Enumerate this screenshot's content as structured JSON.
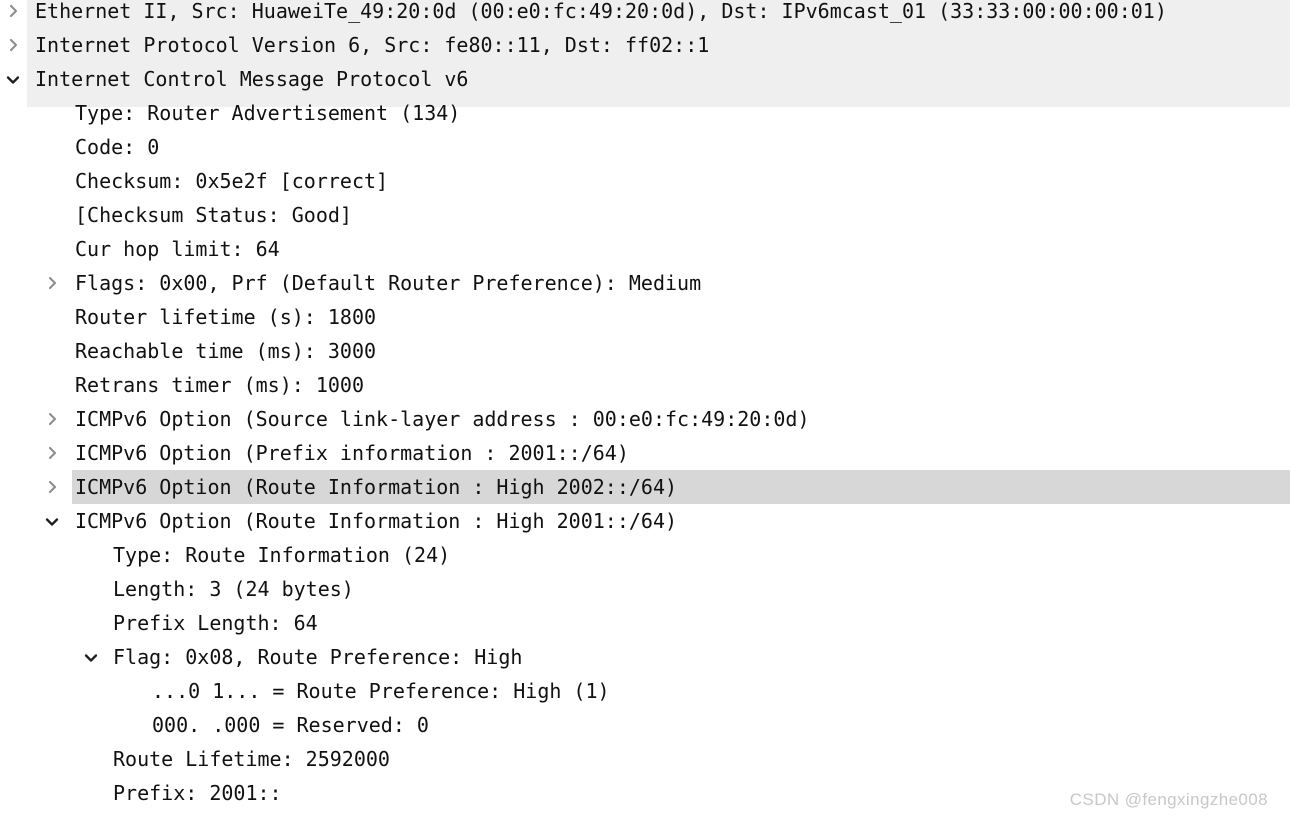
{
  "watermark": "CSDN @fengxingzhe008",
  "colors": {
    "band_background": "#efeff0",
    "selection_background": "#d7d7d7",
    "text": "#111111",
    "collapsed_arrow": "#8d8d8d",
    "expanded_arrow": "#1d1d1d",
    "watermark": "#c8c8c8"
  },
  "packet_detail": {
    "rows": [
      {
        "text": "Ethernet II, Src: HuaweiTe_49:20:0d (00:e0:fc:49:20:0d), Dst: IPv6mcast_01 (33:33:00:00:00:01)",
        "indent": 0,
        "twisty": "collapsed",
        "banded": true,
        "selected": false
      },
      {
        "text": "Internet Protocol Version 6, Src: fe80::11, Dst: ff02::1",
        "indent": 0,
        "twisty": "collapsed",
        "banded": true,
        "selected": false
      },
      {
        "text": "Internet Control Message Protocol v6",
        "indent": 0,
        "twisty": "expanded",
        "banded": true,
        "selected": false
      },
      {
        "text": "Type: Router Advertisement (134)",
        "indent": 1,
        "twisty": "none",
        "banded": false,
        "selected": false
      },
      {
        "text": "Code: 0",
        "indent": 1,
        "twisty": "none",
        "banded": false,
        "selected": false
      },
      {
        "text": "Checksum: 0x5e2f [correct]",
        "indent": 1,
        "twisty": "none",
        "banded": false,
        "selected": false
      },
      {
        "text": "[Checksum Status: Good]",
        "indent": 1,
        "twisty": "none",
        "banded": false,
        "selected": false
      },
      {
        "text": "Cur hop limit: 64",
        "indent": 1,
        "twisty": "none",
        "banded": false,
        "selected": false
      },
      {
        "text": "Flags: 0x00, Prf (Default Router Preference): Medium",
        "indent": 1,
        "twisty": "collapsed",
        "banded": false,
        "selected": false
      },
      {
        "text": "Router lifetime (s): 1800",
        "indent": 1,
        "twisty": "none",
        "banded": false,
        "selected": false
      },
      {
        "text": "Reachable time (ms): 3000",
        "indent": 1,
        "twisty": "none",
        "banded": false,
        "selected": false
      },
      {
        "text": "Retrans timer (ms): 1000",
        "indent": 1,
        "twisty": "none",
        "banded": false,
        "selected": false
      },
      {
        "text": "ICMPv6 Option (Source link-layer address : 00:e0:fc:49:20:0d)",
        "indent": 1,
        "twisty": "collapsed",
        "banded": false,
        "selected": false
      },
      {
        "text": "ICMPv6 Option (Prefix information : 2001::/64)",
        "indent": 1,
        "twisty": "collapsed",
        "banded": false,
        "selected": false
      },
      {
        "text": "ICMPv6 Option (Route Information : High 2002::/64)",
        "indent": 1,
        "twisty": "collapsed",
        "banded": false,
        "selected": true
      },
      {
        "text": "ICMPv6 Option (Route Information : High 2001::/64)",
        "indent": 1,
        "twisty": "expanded",
        "banded": false,
        "selected": false
      },
      {
        "text": "Type: Route Information (24)",
        "indent": 2,
        "twisty": "none",
        "banded": false,
        "selected": false
      },
      {
        "text": "Length: 3 (24 bytes)",
        "indent": 2,
        "twisty": "none",
        "banded": false,
        "selected": false
      },
      {
        "text": "Prefix Length: 64",
        "indent": 2,
        "twisty": "none",
        "banded": false,
        "selected": false
      },
      {
        "text": "Flag: 0x08, Route Preference: High",
        "indent": 2,
        "twisty": "expanded",
        "banded": false,
        "selected": false
      },
      {
        "text": "...0 1... = Route Preference: High (1)",
        "indent": 3,
        "twisty": "none",
        "banded": false,
        "selected": false
      },
      {
        "text": "000. .000 = Reserved: 0",
        "indent": 3,
        "twisty": "none",
        "banded": false,
        "selected": false
      },
      {
        "text": "Route Lifetime: 2592000",
        "indent": 2,
        "twisty": "none",
        "banded": false,
        "selected": false
      },
      {
        "text": "Prefix: 2001::",
        "indent": 2,
        "twisty": "none",
        "banded": false,
        "selected": false
      }
    ]
  }
}
